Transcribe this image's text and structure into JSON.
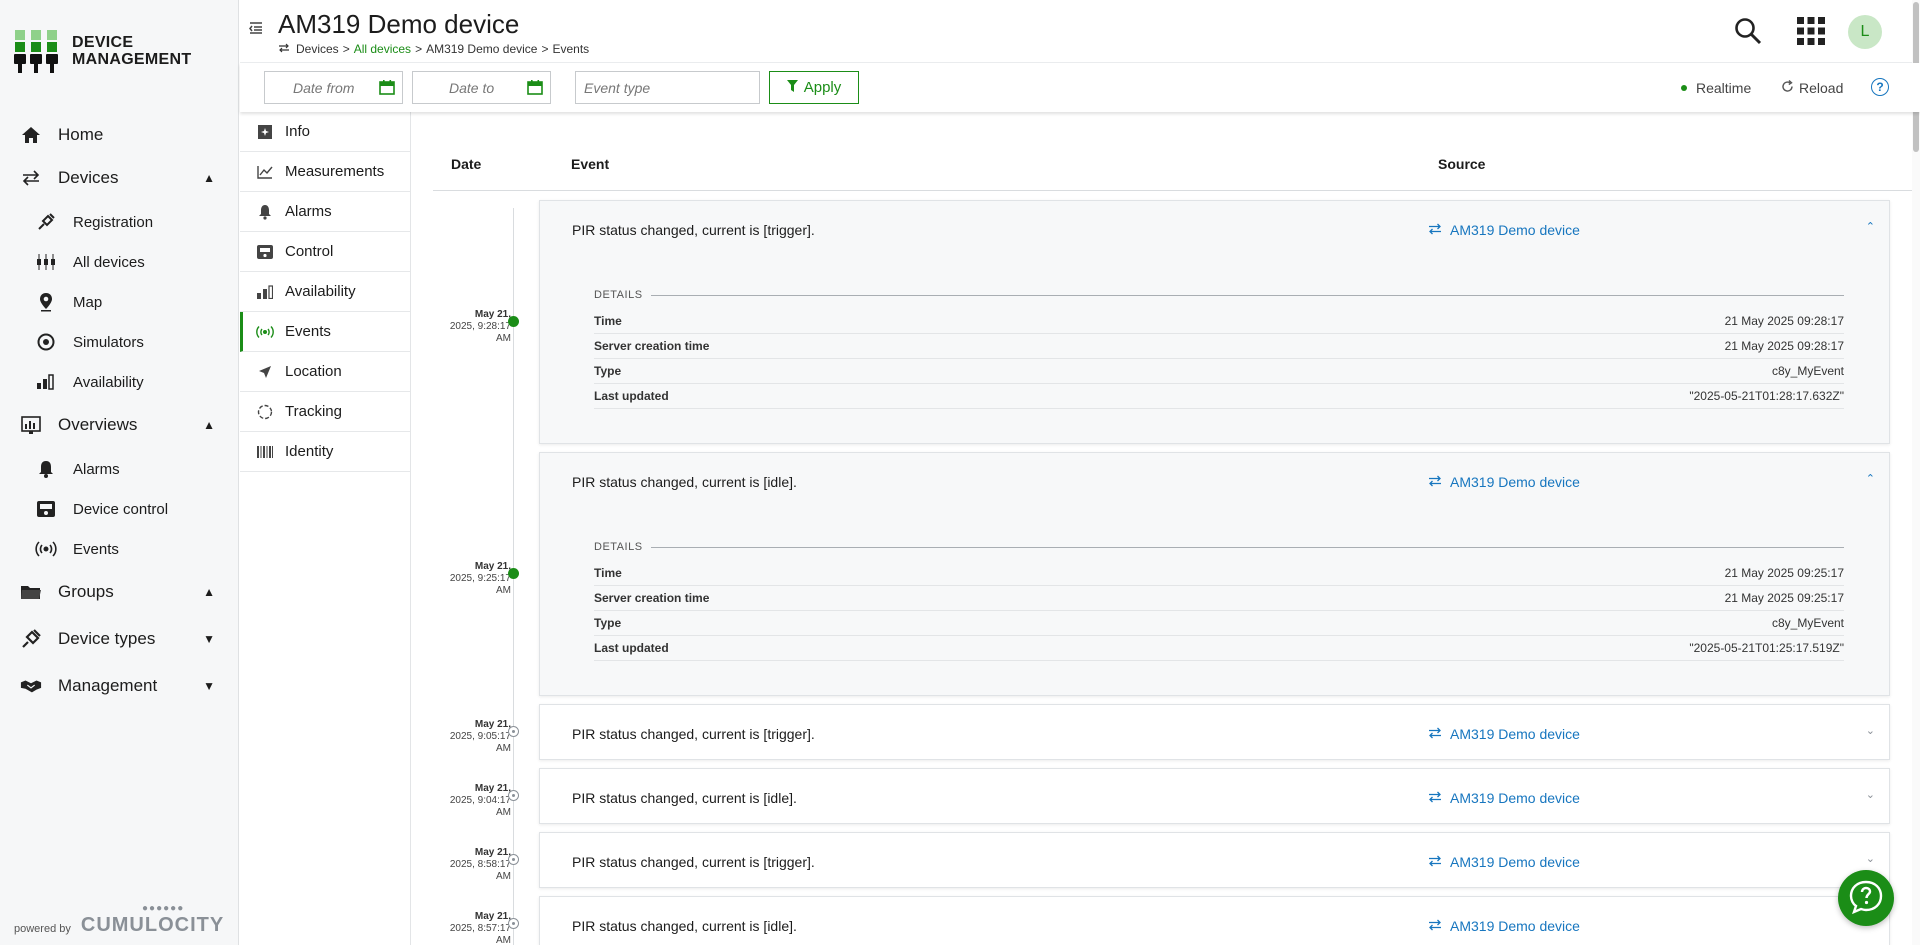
{
  "app": {
    "logo_line1": "DEVICE",
    "logo_line2": "MANAGEMENT",
    "powered_by": "powered by",
    "brand": "CUMULOCITY"
  },
  "colors": {
    "accent": "#1b8d17",
    "link": "#1776bf"
  },
  "nav": {
    "home": "Home",
    "devices": "Devices",
    "devices_sub": [
      "Registration",
      "All devices",
      "Map",
      "Simulators",
      "Availability"
    ],
    "overviews": "Overviews",
    "overviews_sub": [
      "Alarms",
      "Device control",
      "Events"
    ],
    "groups": "Groups",
    "device_types": "Device types",
    "management": "Management"
  },
  "header": {
    "title": "AM319 Demo device",
    "breadcrumb": [
      "Devices",
      "All devices",
      "AM319 Demo device",
      "Events"
    ],
    "breadcrumb_sep": ">",
    "avatar_letter": "L"
  },
  "actionbar": {
    "date_from_placeholder": "Date from",
    "date_to_placeholder": "Date to",
    "event_type_placeholder": "Event type",
    "apply": "Apply",
    "realtime": "Realtime",
    "reload": "Reload"
  },
  "tabs": [
    "Info",
    "Measurements",
    "Alarms",
    "Control",
    "Availability",
    "Events",
    "Location",
    "Tracking",
    "Identity"
  ],
  "active_tab": "Events",
  "table": {
    "col_date": "Date",
    "col_event": "Event",
    "col_source": "Source"
  },
  "details_labels": {
    "heading": "DETAILS",
    "time": "Time",
    "server_creation_time": "Server creation time",
    "type": "Type",
    "last_updated": "Last updated"
  },
  "events": [
    {
      "date_line1": "May 21,",
      "date_line2": "2025, 9:28:17",
      "date_line3": "AM",
      "text": "PIR status changed, current is [trigger].",
      "source": "AM319 Demo device",
      "expanded": true,
      "details": {
        "time": "21 May 2025 09:28:17",
        "server_creation_time": "21 May 2025 09:28:17",
        "type": "c8y_MyEvent",
        "last_updated": "\"2025-05-21T01:28:17.632Z\""
      }
    },
    {
      "date_line1": "May 21,",
      "date_line2": "2025, 9:25:17",
      "date_line3": "AM",
      "text": "PIR status changed, current is [idle].",
      "source": "AM319 Demo device",
      "expanded": true,
      "details": {
        "time": "21 May 2025 09:25:17",
        "server_creation_time": "21 May 2025 09:25:17",
        "type": "c8y_MyEvent",
        "last_updated": "\"2025-05-21T01:25:17.519Z\""
      }
    },
    {
      "date_line1": "May 21,",
      "date_line2": "2025, 9:05:17",
      "date_line3": "AM",
      "text": "PIR status changed, current is [trigger].",
      "source": "AM319 Demo device",
      "expanded": false
    },
    {
      "date_line1": "May 21,",
      "date_line2": "2025, 9:04:17",
      "date_line3": "AM",
      "text": "PIR status changed, current is [idle].",
      "source": "AM319 Demo device",
      "expanded": false
    },
    {
      "date_line1": "May 21,",
      "date_line2": "2025, 8:58:17",
      "date_line3": "AM",
      "text": "PIR status changed, current is [trigger].",
      "source": "AM319 Demo device",
      "expanded": false
    },
    {
      "date_line1": "May 21,",
      "date_line2": "2025, 8:57:17",
      "date_line3": "AM",
      "text": "PIR status changed, current is [idle].",
      "source": "AM319 Demo device",
      "expanded": false
    }
  ]
}
